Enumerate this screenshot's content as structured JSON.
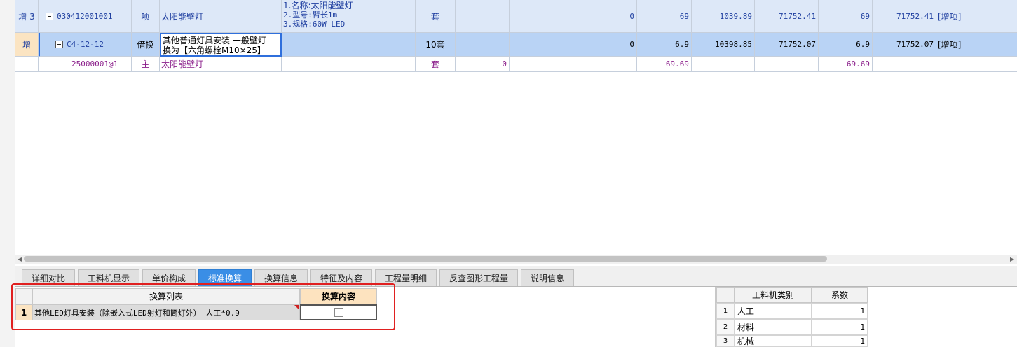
{
  "grid": {
    "row1": {
      "tag": "增 3",
      "code": "030412001001",
      "type": "项",
      "name": "太阳能壁灯",
      "features": [
        "1.名称:太阳能壁灯",
        "2.型号:臂长1m",
        "3.规格:60W LED"
      ],
      "unit": "套",
      "v_qty": "0",
      "v_a": "69",
      "v_b": "1039.89",
      "v_c": "71752.41",
      "v_d": "69",
      "v_e": "71752.41",
      "remark": "[增项]"
    },
    "row2": {
      "tag": "增",
      "code": "C4-12-12",
      "type": "借换",
      "name_line1": "其他普通灯具安装 一般壁灯",
      "name_line2": "换为【六角螺栓M10×25】",
      "unit": "10套",
      "v_qty": "0",
      "v_a": "6.9",
      "v_b": "10398.85",
      "v_c": "71752.07",
      "v_d": "6.9",
      "v_e": "71752.07",
      "remark": "[增项]"
    },
    "row3": {
      "code": "25000001@1",
      "type": "主",
      "name": "太阳能壁灯",
      "unit": "套",
      "v_zero": "0",
      "v_a": "69.69",
      "v_d": "69.69"
    }
  },
  "tabs": [
    "详细对比",
    "工料机显示",
    "单价构成",
    "标准换算",
    "换算信息",
    "特征及内容",
    "工程量明细",
    "反查图形工程量",
    "说明信息"
  ],
  "active_tab": "标准换算",
  "conversion": {
    "col_list": "换算列表",
    "col_content": "换算内容",
    "rows": [
      {
        "num": "1",
        "text": "其他LED灯具安装（除嵌入式LED射灯和筒灯外） 人工*0.9",
        "checked": false
      }
    ]
  },
  "category": {
    "col_type": "工料机类别",
    "col_coef": "系数",
    "rows": [
      {
        "num": "1",
        "type": "人工",
        "coef": "1"
      },
      {
        "num": "2",
        "type": "材料",
        "coef": "1"
      },
      {
        "num": "3",
        "type": "机械",
        "coef": "1"
      }
    ]
  },
  "colors": {
    "active_tab": "#3a8ee6",
    "highlight": "#e02020",
    "row_selected": "#b9d3f5"
  }
}
